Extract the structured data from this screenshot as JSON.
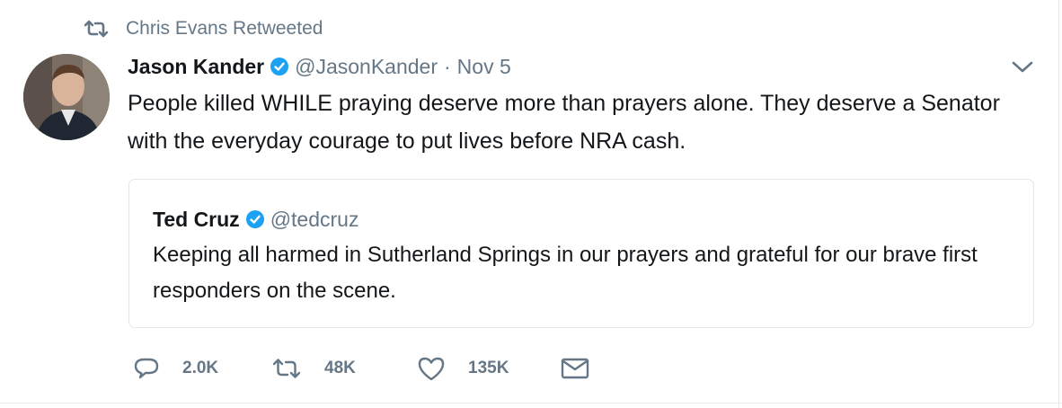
{
  "retweet_context": {
    "text": "Chris Evans Retweeted",
    "icon": "retweet-icon"
  },
  "tweet": {
    "author": {
      "name": "Jason Kander",
      "handle": "@JasonKander",
      "verified": true
    },
    "separator": "·",
    "time": "Nov 5",
    "text": "People killed WHILE praying deserve more than prayers alone. They deserve a Senator with the everyday courage to put lives before NRA cash."
  },
  "quoted_tweet": {
    "author": {
      "name": "Ted Cruz",
      "handle": "@tedcruz",
      "verified": true
    },
    "text": "Keeping all harmed in Sutherland Springs in our prayers and grateful for our brave first responders on the scene."
  },
  "actions": {
    "reply_count": "2.0K",
    "retweet_count": "48K",
    "like_count": "135K"
  },
  "colors": {
    "verified_blue": "#1da1f2",
    "muted_gray": "#657786",
    "text": "#14171a",
    "border": "#e1e8ed"
  }
}
